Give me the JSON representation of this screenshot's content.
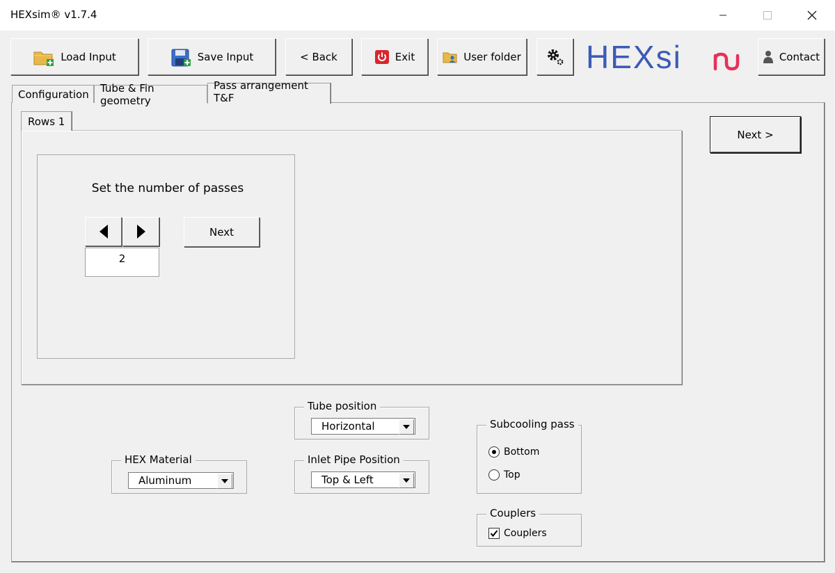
{
  "window": {
    "title": "HEXsim® v1.7.4"
  },
  "toolbar": {
    "load_input": "Load Input",
    "save_input": "Save Input",
    "back": "< Back",
    "exit": "Exit",
    "user_folder": "User folder",
    "contact": "Contact"
  },
  "logo": {
    "text_main": "HEXsi",
    "color_main": "#3b5bb5",
    "color_accent": "#e5305a"
  },
  "tabs": [
    {
      "label": "Configuration"
    },
    {
      "label": "Tube & Fin geometry"
    },
    {
      "label": "Pass arrangement T&F"
    }
  ],
  "inner_tab": {
    "label": "Rows 1"
  },
  "passes": {
    "prompt": "Set the number of passes",
    "value": "2",
    "next_label": "Next"
  },
  "next_main": "Next >",
  "hex_material": {
    "legend": "HEX Material",
    "value": "Aluminum"
  },
  "tube_position": {
    "legend": "Tube position",
    "value": "Horizontal"
  },
  "inlet_pipe": {
    "legend": "Inlet Pipe Position",
    "value": "Top & Left"
  },
  "subcooling": {
    "legend": "Subcooling pass",
    "options": [
      "Bottom",
      "Top"
    ],
    "selected": "Bottom"
  },
  "couplers": {
    "legend": "Couplers",
    "label": "Couplers",
    "checked": true
  }
}
